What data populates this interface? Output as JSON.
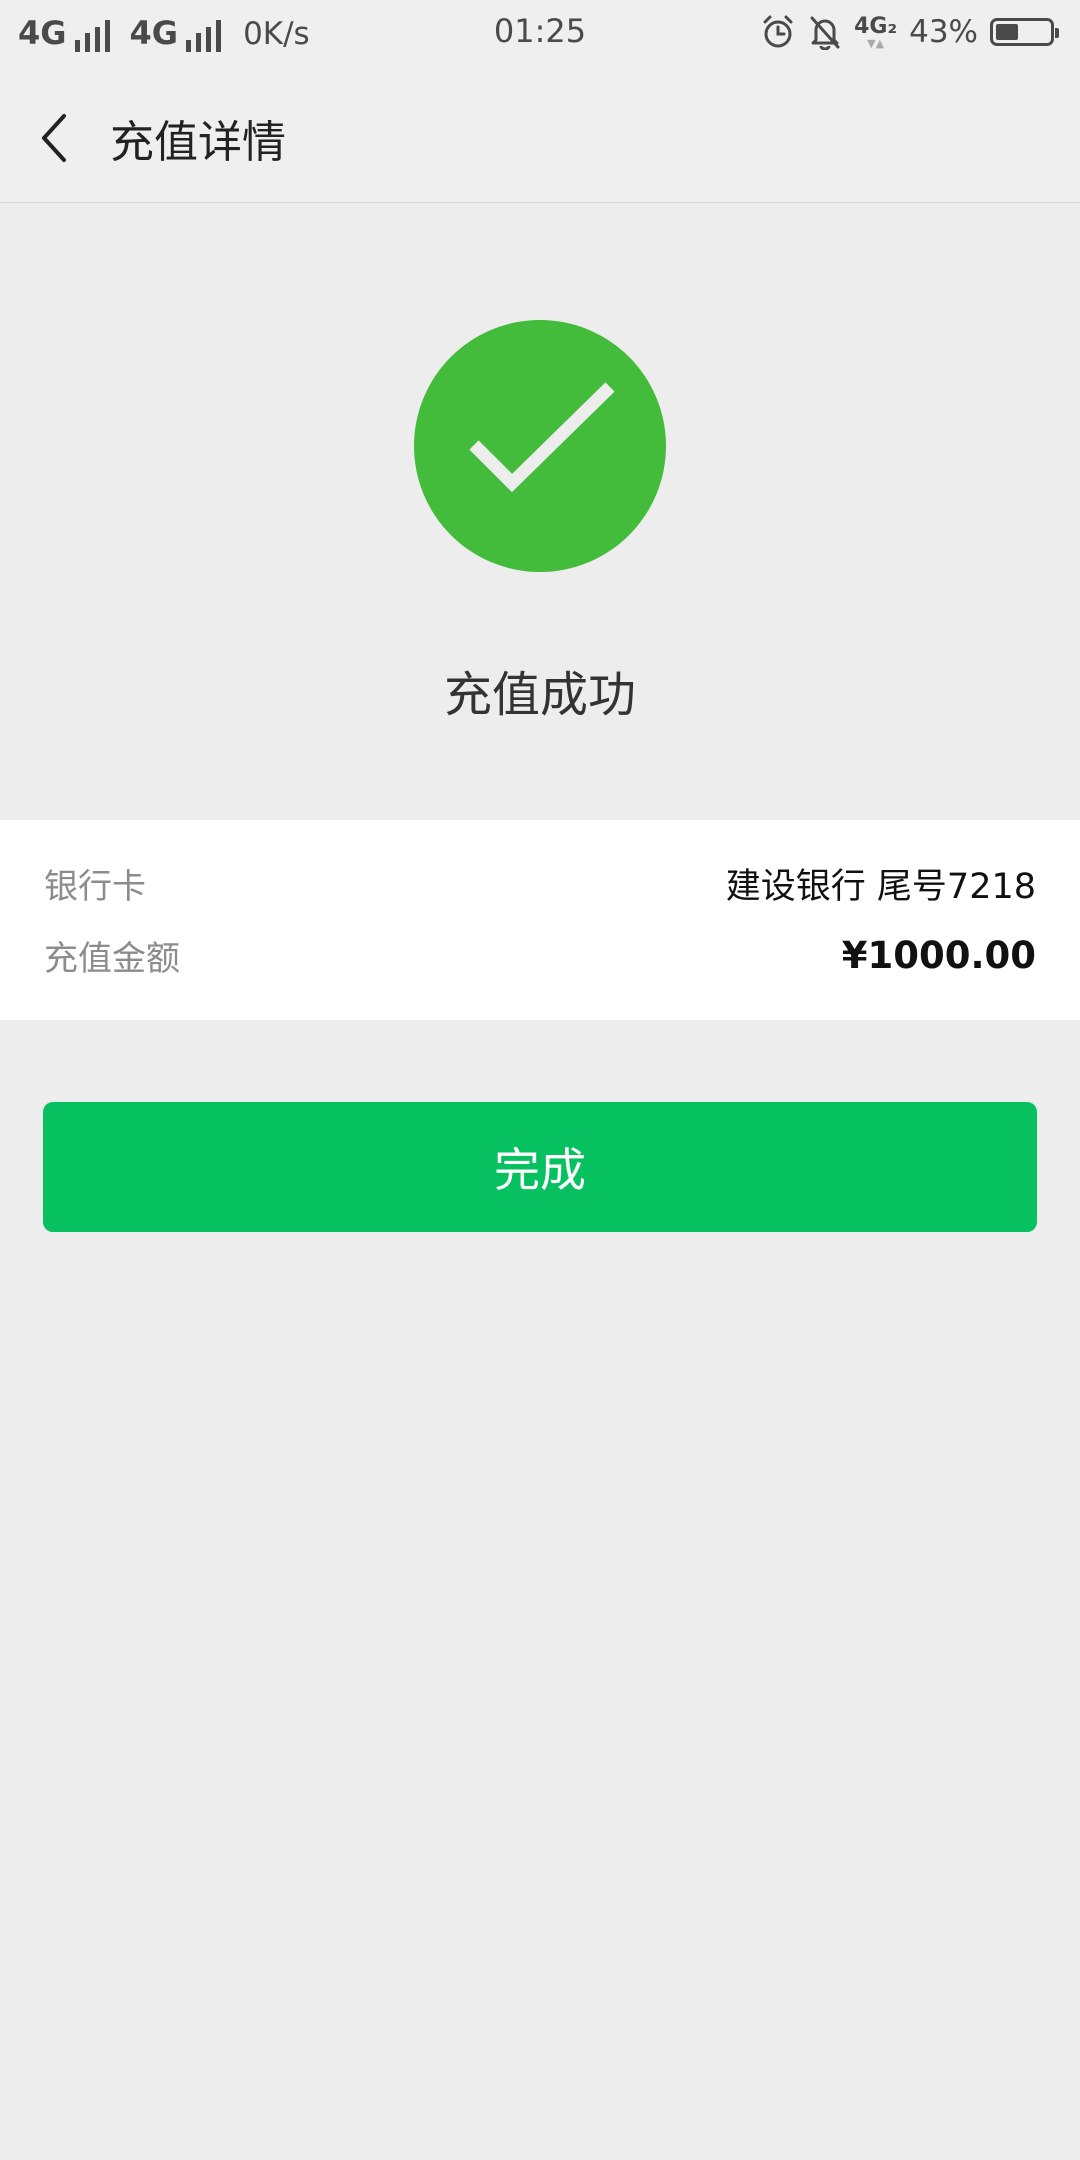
{
  "status_bar": {
    "network_1": "4G",
    "network_2": "4G",
    "speed": "0K/s",
    "time": "01:25",
    "sim2_label": "4G₂",
    "battery_percent": "43%",
    "battery_level": 0.43,
    "icons": [
      "signal-bars-icon",
      "alarm-clock-icon",
      "bell-muted-icon",
      "battery-icon"
    ]
  },
  "nav": {
    "title": "充值详情",
    "back_icon": "chevron-left-icon"
  },
  "result": {
    "icon": "checkmark-circle-icon",
    "title": "充值成功"
  },
  "details": {
    "rows": [
      {
        "label": "银行卡",
        "value": "建设银行 尾号7218"
      },
      {
        "label": "充值金额",
        "value": "¥1000.00"
      }
    ]
  },
  "actions": {
    "done_label": "完成"
  },
  "colors": {
    "success_green": "#43bb3b",
    "button_green": "#07c160",
    "page_background": "#ededed",
    "card_background": "#ffffff"
  }
}
